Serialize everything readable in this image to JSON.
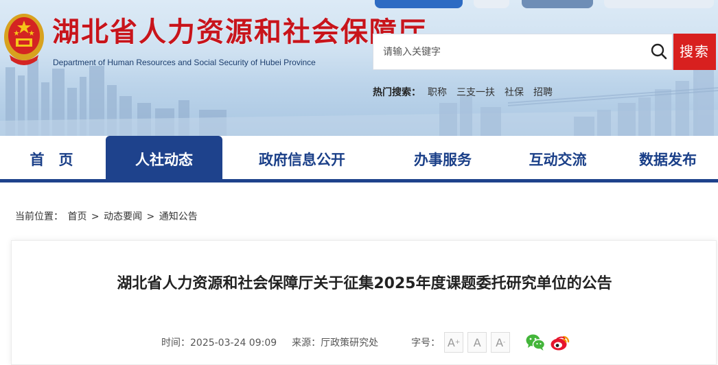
{
  "header": {
    "title": "湖北省人力资源和社会保障厅",
    "subtitle": "Department of Human Resources and Social Security of Hubei Province"
  },
  "search": {
    "placeholder": "请输入关键字",
    "button_label": "搜索",
    "hot_label": "热门搜索：",
    "hot_items": [
      "职称",
      "三支一扶",
      "社保",
      "招聘"
    ]
  },
  "nav": {
    "items": [
      {
        "label": "首　页"
      },
      {
        "label": "人社动态"
      },
      {
        "label": "政府信息公开"
      },
      {
        "label": "办事服务"
      },
      {
        "label": "互动交流"
      },
      {
        "label": "数据发布"
      }
    ],
    "active_index": 1
  },
  "breadcrumb": {
    "prefix": "当前位置：",
    "items": [
      "首页",
      "动态要闻",
      "通知公告"
    ],
    "separator": ">"
  },
  "article": {
    "title": "湖北省人力资源和社会保障厅关于征集2025年度课题委托研究单位的公告",
    "time_label": "时间：",
    "time": "2025-03-24 09:09",
    "source_label": "来源：",
    "source": "厅政策研究处",
    "font_size_label": "字号：",
    "font_size_options": [
      "A",
      "A",
      "A"
    ]
  },
  "share": {
    "icons": [
      "wechat-icon",
      "weibo-icon"
    ]
  },
  "colors": {
    "brand_red": "#c8141b",
    "search_red": "#d8201f",
    "nav_blue": "#1e428c",
    "nav_text": "#1a3f88"
  }
}
